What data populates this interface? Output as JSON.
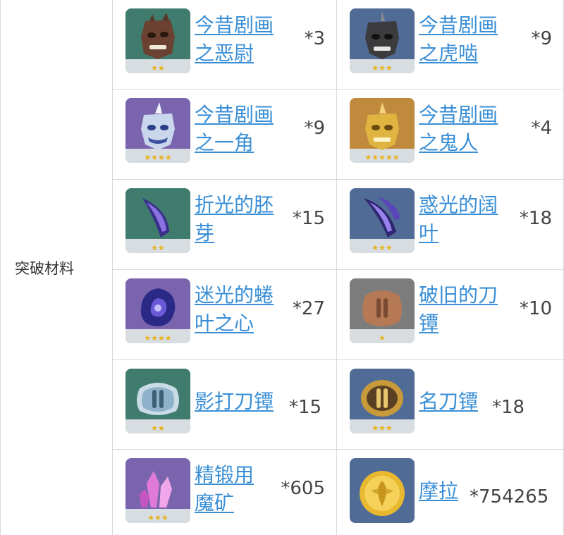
{
  "section_label": "突破材料",
  "items": [
    {
      "name_line1": "今昔剧画",
      "name_line2": "之恶尉",
      "count": "*3",
      "icon": "mask-brown-icon",
      "stars": 2,
      "bg": "#3f7c6e"
    },
    {
      "name_line1": "今昔剧画",
      "name_line2": "之虎啮",
      "count": "*9",
      "icon": "mask-gray-icon",
      "stars": 3,
      "bg": "#506b95"
    },
    {
      "name_line1": "今昔剧画",
      "name_line2": "之一角",
      "count": "*9",
      "icon": "mask-blue-icon",
      "stars": 4,
      "bg": "#7a64ad"
    },
    {
      "name_line1": "今昔剧画",
      "name_line2": "之鬼人",
      "count": "*4",
      "icon": "mask-gold-icon",
      "stars": 5,
      "bg": "#c08a3e"
    },
    {
      "name_line1": "折光的胚",
      "name_line2": "芽",
      "count": "*15",
      "icon": "blade-sprout-icon",
      "stars": 2,
      "bg": "#3f7c6e"
    },
    {
      "name_line1": "惑光的阔",
      "name_line2": "叶",
      "count": "*18",
      "icon": "blade-leaf-icon",
      "stars": 3,
      "bg": "#506b95"
    },
    {
      "name_line1": "迷光的蜷",
      "name_line2": "叶之心",
      "count": "*27",
      "icon": "swirl-heart-icon",
      "stars": 4,
      "bg": "#7a64ad"
    },
    {
      "name_line1": "破旧的刀",
      "name_line2": "镡",
      "count": "*10",
      "icon": "old-guard-icon",
      "stars": 1,
      "bg": "#7c7c7c"
    },
    {
      "name_line1": "影打刀镡",
      "name_line2": "",
      "count": "*15",
      "icon": "silver-guard-icon",
      "stars": 2,
      "bg": "#3f7c6e"
    },
    {
      "name_line1": "名刀镡",
      "name_line2": "",
      "count": "*18",
      "icon": "gold-guard-icon",
      "stars": 3,
      "bg": "#506b95"
    },
    {
      "name_line1": "精锻用",
      "name_line2": "魔矿",
      "count": "*605",
      "icon": "crystal-ore-icon",
      "stars": 3,
      "bg": "#7a64ad"
    },
    {
      "name_line1": "摩拉",
      "name_line2": "",
      "count": "*754265",
      "icon": "mora-coin-icon",
      "stars": 0,
      "bg": "#506b95"
    }
  ]
}
